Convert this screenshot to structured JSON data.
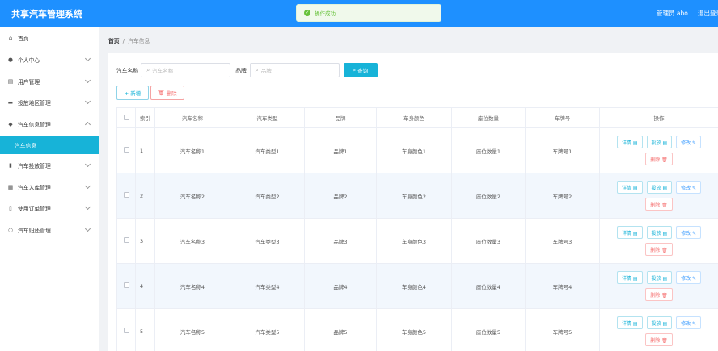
{
  "header": {
    "title": "共享汽车管理系统",
    "user": "管理员 abo",
    "logout": "退出登录"
  },
  "toast": {
    "message": "操作成功"
  },
  "sidebar": {
    "items": [
      {
        "label": "首页",
        "icon": "home-icon",
        "chevron": false
      },
      {
        "label": "个人中心",
        "icon": "user-icon",
        "chevron": true
      },
      {
        "label": "用户管理",
        "icon": "users-icon",
        "chevron": true
      },
      {
        "label": "投放地区管理",
        "icon": "monitor-icon",
        "chevron": true
      },
      {
        "label": "汽车信息管理",
        "icon": "location-icon",
        "chevron": true,
        "expanded": true
      },
      {
        "label": "汽车投放管理",
        "icon": "bar-chart-icon",
        "chevron": true
      },
      {
        "label": "汽车入库管理",
        "icon": "box-icon",
        "chevron": true
      },
      {
        "label": "使用订单管理",
        "icon": "phone-icon",
        "chevron": true
      },
      {
        "label": "汽车归还管理",
        "icon": "circle-icon",
        "chevron": true
      }
    ],
    "active_sub": "汽车信息"
  },
  "breadcrumb": {
    "home": "首页",
    "separator": "/",
    "current": "汽车信息"
  },
  "search": {
    "name_label": "汽车名称",
    "name_placeholder": "汽车名称",
    "brand_label": "品牌",
    "brand_placeholder": "品牌",
    "query_label": "查询"
  },
  "actions": {
    "add_label": "+ 新增",
    "delete_label": "删除"
  },
  "table": {
    "headers": [
      "",
      "索引",
      "汽车名称",
      "汽车类型",
      "品牌",
      "车身颜色",
      "座位数量",
      "车牌号",
      "操作"
    ],
    "rows": [
      {
        "index": "1",
        "name": "汽车名称1",
        "type": "汽车类型1",
        "brand": "品牌1",
        "color": "车身颜色1",
        "seats": "座位数量1",
        "plate": "车牌号1"
      },
      {
        "index": "2",
        "name": "汽车名称2",
        "type": "汽车类型2",
        "brand": "品牌2",
        "color": "车身颜色2",
        "seats": "座位数量2",
        "plate": "车牌号2"
      },
      {
        "index": "3",
        "name": "汽车名称3",
        "type": "汽车类型3",
        "brand": "品牌3",
        "color": "车身颜色3",
        "seats": "座位数量3",
        "plate": "车牌号3"
      },
      {
        "index": "4",
        "name": "汽车名称4",
        "type": "汽车类型4",
        "brand": "品牌4",
        "color": "车身颜色4",
        "seats": "座位数量4",
        "plate": "车牌号4"
      },
      {
        "index": "5",
        "name": "汽车名称5",
        "type": "汽车类型5",
        "brand": "品牌5",
        "color": "车身颜色5",
        "seats": "座位数量5",
        "plate": "车牌号5"
      }
    ],
    "row_actions": {
      "detail": "详情 ▤",
      "report": "投放 ▤",
      "edit": "修改 ✎",
      "delete": "删除 🗑"
    }
  },
  "colors": {
    "header": "#1e90ff",
    "accent": "#17b3d8",
    "danger": "#f56c6c",
    "success": "#67c23a"
  }
}
